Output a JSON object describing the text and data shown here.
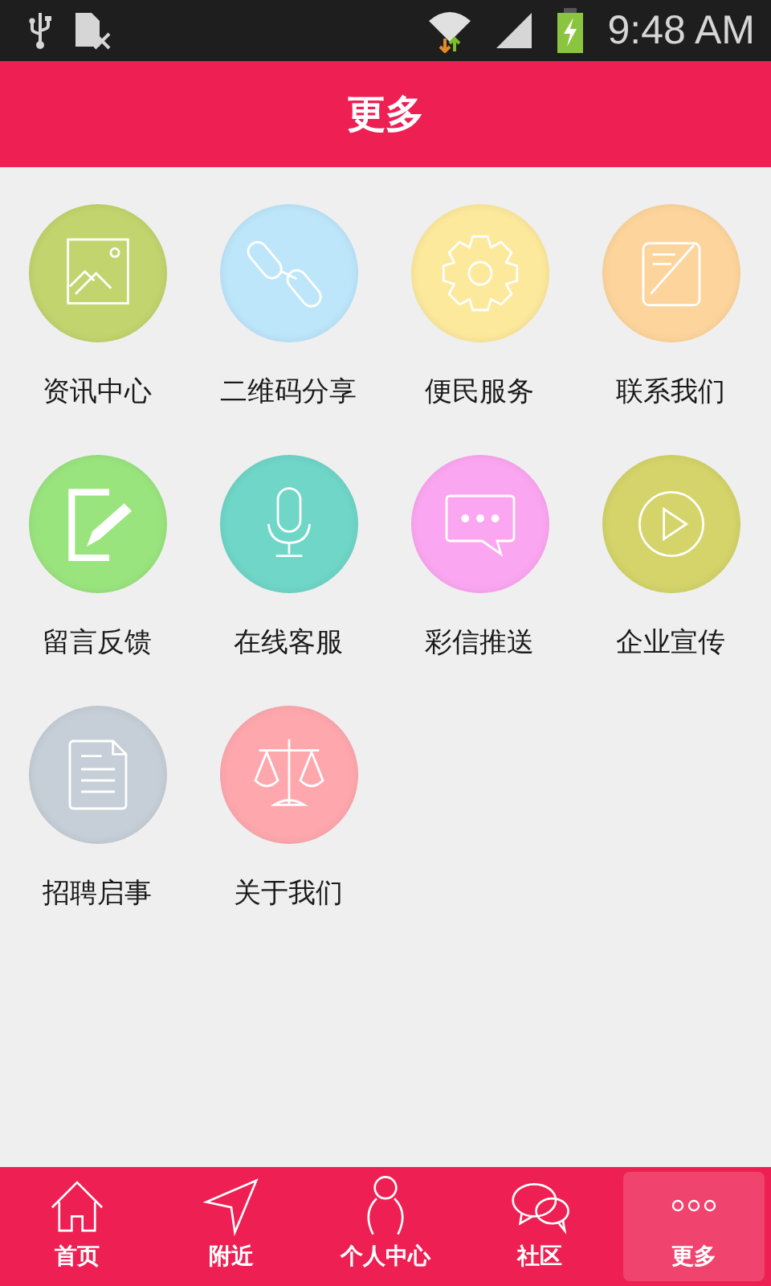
{
  "status_bar": {
    "time": "9:48 AM"
  },
  "header": {
    "title": "更多"
  },
  "items": [
    {
      "label": "资讯中心",
      "kind": "image",
      "color": "#c2d46e"
    },
    {
      "label": "二维码分享",
      "kind": "link",
      "color": "#bde6fb"
    },
    {
      "label": "便民服务",
      "kind": "gear",
      "color": "#fde99c"
    },
    {
      "label": "联系我们",
      "kind": "note",
      "color": "#fdd59c"
    },
    {
      "label": "留言反馈",
      "kind": "edit",
      "color": "#9ae47e"
    },
    {
      "label": "在线客服",
      "kind": "mic",
      "color": "#6fd6c8"
    },
    {
      "label": "彩信推送",
      "kind": "chat",
      "color": "#fba6f1"
    },
    {
      "label": "企业宣传",
      "kind": "play",
      "color": "#d4d46a"
    },
    {
      "label": "招聘启事",
      "kind": "document",
      "color": "#c6ced7"
    },
    {
      "label": "关于我们",
      "kind": "scale",
      "color": "#fea8ae"
    }
  ],
  "nav": [
    {
      "label": "首页",
      "kind": "home",
      "selected": false
    },
    {
      "label": "附近",
      "kind": "navigate",
      "selected": false
    },
    {
      "label": "个人中心",
      "kind": "person",
      "selected": false
    },
    {
      "label": "社区",
      "kind": "chat",
      "selected": false
    },
    {
      "label": "更多",
      "kind": "more",
      "selected": true
    }
  ]
}
